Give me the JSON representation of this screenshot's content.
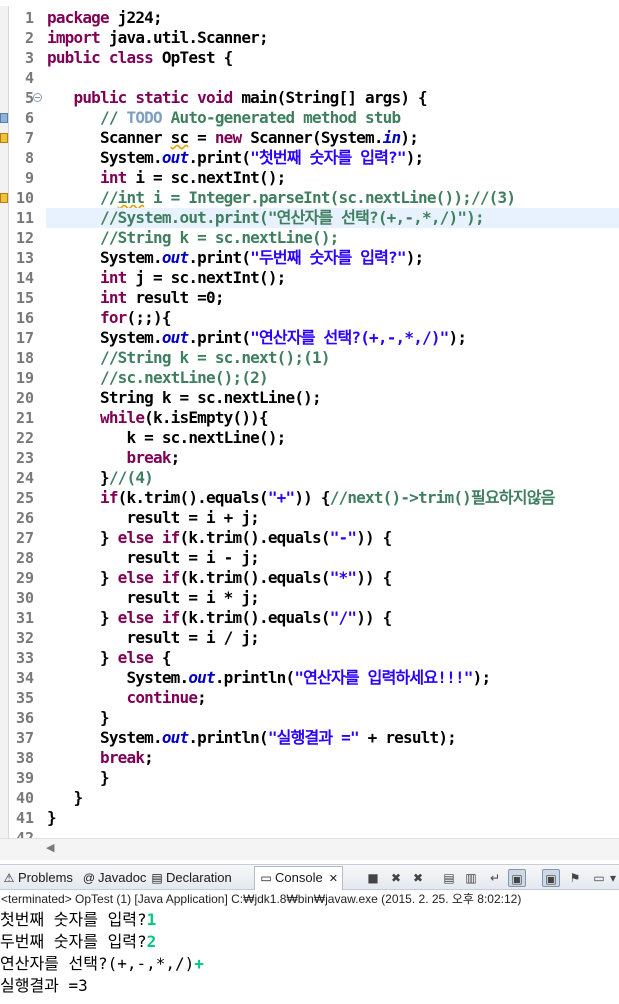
{
  "editor": {
    "lines": [
      {
        "n": "1",
        "code": [
          {
            "t": "package ",
            "c": "kw"
          },
          {
            "t": "j224;",
            "c": ""
          }
        ]
      },
      {
        "n": "2",
        "code": [
          {
            "t": "import ",
            "c": "kw"
          },
          {
            "t": "java.util.Scanner;",
            "c": ""
          }
        ]
      },
      {
        "n": "3",
        "code": [
          {
            "t": "public class ",
            "c": "kw"
          },
          {
            "t": "OpTest {",
            "c": ""
          }
        ]
      },
      {
        "n": "4",
        "code": []
      },
      {
        "n": "5",
        "code": [
          {
            "t": "   public static void ",
            "c": "kw"
          },
          {
            "t": "main(String[] args) {",
            "c": ""
          }
        ]
      },
      {
        "n": "6",
        "code": [
          {
            "t": "      // ",
            "c": "cm"
          },
          {
            "t": "TODO",
            "c": "todo"
          },
          {
            "t": " Auto-generated method stub",
            "c": "cm"
          }
        ]
      },
      {
        "n": "7",
        "code": [
          {
            "t": "      Scanner ",
            "c": ""
          },
          {
            "t": "sc",
            "c": "sq"
          },
          {
            "t": " = ",
            "c": ""
          },
          {
            "t": "new ",
            "c": "kw"
          },
          {
            "t": "Scanner(System.",
            "c": ""
          },
          {
            "t": "in",
            "c": "fld"
          },
          {
            "t": ");",
            "c": ""
          }
        ]
      },
      {
        "n": "8",
        "code": [
          {
            "t": "      System.",
            "c": ""
          },
          {
            "t": "out",
            "c": "fld"
          },
          {
            "t": ".print(",
            "c": ""
          },
          {
            "t": "\"첫번째 숫자를 입력?\"",
            "c": "str"
          },
          {
            "t": ");",
            "c": ""
          }
        ]
      },
      {
        "n": "9",
        "code": [
          {
            "t": "      int ",
            "c": "kw"
          },
          {
            "t": "i = sc.nextInt();",
            "c": ""
          }
        ]
      },
      {
        "n": "10",
        "code": [
          {
            "t": "      //",
            "c": "cm"
          },
          {
            "t": "int",
            "c": "cmsq"
          },
          {
            "t": " i = Integer.parseInt(sc.nextLine());//(3)",
            "c": "cm"
          }
        ]
      },
      {
        "n": "11",
        "code": [
          {
            "t": "      //System.out.print(\"연산자를 선택?(+,-,*,/)\");",
            "c": "cm"
          }
        ]
      },
      {
        "n": "12",
        "code": [
          {
            "t": "      //String k = sc.nextLine();",
            "c": "cm"
          }
        ]
      },
      {
        "n": "13",
        "code": [
          {
            "t": "      System.",
            "c": ""
          },
          {
            "t": "out",
            "c": "fld"
          },
          {
            "t": ".print(",
            "c": ""
          },
          {
            "t": "\"두번째 숫자를 입력?\"",
            "c": "str"
          },
          {
            "t": ");",
            "c": ""
          }
        ]
      },
      {
        "n": "14",
        "code": [
          {
            "t": "      int ",
            "c": "kw"
          },
          {
            "t": "j = sc.nextInt();",
            "c": ""
          }
        ]
      },
      {
        "n": "15",
        "code": [
          {
            "t": "      int ",
            "c": "kw"
          },
          {
            "t": "result =0;",
            "c": ""
          }
        ]
      },
      {
        "n": "16",
        "code": [
          {
            "t": "      for",
            "c": "kw"
          },
          {
            "t": "(;;){",
            "c": ""
          }
        ]
      },
      {
        "n": "17",
        "code": [
          {
            "t": "      System.",
            "c": ""
          },
          {
            "t": "out",
            "c": "fld"
          },
          {
            "t": ".print(",
            "c": ""
          },
          {
            "t": "\"연산자를 선택?(+,-,*,/)\"",
            "c": "str"
          },
          {
            "t": ");",
            "c": ""
          }
        ]
      },
      {
        "n": "18",
        "code": [
          {
            "t": "      //String k = sc.next();(1)",
            "c": "cm"
          }
        ]
      },
      {
        "n": "19",
        "code": [
          {
            "t": "      //sc.nextLine();(2)",
            "c": "cm"
          }
        ]
      },
      {
        "n": "20",
        "code": [
          {
            "t": "      String k = sc.nextLine();",
            "c": ""
          }
        ]
      },
      {
        "n": "21",
        "code": [
          {
            "t": "      while",
            "c": "kw"
          },
          {
            "t": "(k.isEmpty()){",
            "c": ""
          }
        ]
      },
      {
        "n": "22",
        "code": [
          {
            "t": "         k = sc.nextLine();",
            "c": ""
          }
        ]
      },
      {
        "n": "23",
        "code": [
          {
            "t": "         break",
            "c": "kw"
          },
          {
            "t": ";",
            "c": ""
          }
        ]
      },
      {
        "n": "24",
        "code": [
          {
            "t": "      }",
            "c": ""
          },
          {
            "t": "//(4)",
            "c": "cm"
          }
        ]
      },
      {
        "n": "25",
        "code": [
          {
            "t": "      if",
            "c": "kw"
          },
          {
            "t": "(k.trim().equals(",
            "c": ""
          },
          {
            "t": "\"+\"",
            "c": "str"
          },
          {
            "t": ")) {",
            "c": ""
          },
          {
            "t": "//next()->trim()필요하지않음",
            "c": "cm"
          }
        ]
      },
      {
        "n": "26",
        "code": [
          {
            "t": "         result = i + j;",
            "c": ""
          }
        ]
      },
      {
        "n": "27",
        "code": [
          {
            "t": "      } ",
            "c": ""
          },
          {
            "t": "else if",
            "c": "kw"
          },
          {
            "t": "(k.trim().equals(",
            "c": ""
          },
          {
            "t": "\"-\"",
            "c": "str"
          },
          {
            "t": ")) {",
            "c": ""
          }
        ]
      },
      {
        "n": "28",
        "code": [
          {
            "t": "         result = i - j;",
            "c": ""
          }
        ]
      },
      {
        "n": "29",
        "code": [
          {
            "t": "      } ",
            "c": ""
          },
          {
            "t": "else if",
            "c": "kw"
          },
          {
            "t": "(k.trim().equals(",
            "c": ""
          },
          {
            "t": "\"*\"",
            "c": "str"
          },
          {
            "t": ")) {",
            "c": ""
          }
        ]
      },
      {
        "n": "30",
        "code": [
          {
            "t": "         result = i * j;",
            "c": ""
          }
        ]
      },
      {
        "n": "31",
        "code": [
          {
            "t": "      } ",
            "c": ""
          },
          {
            "t": "else if",
            "c": "kw"
          },
          {
            "t": "(k.trim().equals(",
            "c": ""
          },
          {
            "t": "\"/\"",
            "c": "str"
          },
          {
            "t": ")) {",
            "c": ""
          }
        ]
      },
      {
        "n": "32",
        "code": [
          {
            "t": "         result = i / j;",
            "c": ""
          }
        ]
      },
      {
        "n": "33",
        "code": [
          {
            "t": "      } ",
            "c": ""
          },
          {
            "t": "else",
            "c": "kw"
          },
          {
            "t": " {",
            "c": ""
          }
        ]
      },
      {
        "n": "34",
        "code": [
          {
            "t": "         System.",
            "c": ""
          },
          {
            "t": "out",
            "c": "fld"
          },
          {
            "t": ".println(",
            "c": ""
          },
          {
            "t": "\"연산자를 입력하세요!!!\"",
            "c": "str"
          },
          {
            "t": ");",
            "c": ""
          }
        ]
      },
      {
        "n": "35",
        "code": [
          {
            "t": "         continue",
            "c": "kw"
          },
          {
            "t": ";",
            "c": ""
          }
        ]
      },
      {
        "n": "36",
        "code": [
          {
            "t": "      }",
            "c": ""
          }
        ]
      },
      {
        "n": "37",
        "code": [
          {
            "t": "      System.",
            "c": ""
          },
          {
            "t": "out",
            "c": "fld"
          },
          {
            "t": ".println(",
            "c": ""
          },
          {
            "t": "\"실행결과 =\"",
            "c": "str"
          },
          {
            "t": " + result);",
            "c": ""
          }
        ]
      },
      {
        "n": "38",
        "code": [
          {
            "t": "      break",
            "c": "kw"
          },
          {
            "t": ";",
            "c": ""
          }
        ]
      },
      {
        "n": "39",
        "code": [
          {
            "t": "      }",
            "c": ""
          }
        ]
      },
      {
        "n": "40",
        "code": [
          {
            "t": "   }",
            "c": ""
          }
        ]
      },
      {
        "n": "41",
        "code": [
          {
            "t": "}",
            "c": ""
          }
        ]
      },
      {
        "n": "42",
        "code": []
      }
    ]
  },
  "views": {
    "tabs": [
      {
        "label": "Problems",
        "icon": "problems-icon",
        "glyph": "⚠"
      },
      {
        "label": "Javadoc",
        "icon": "javadoc-icon",
        "glyph": "@"
      },
      {
        "label": "Declaration",
        "icon": "declaration-icon",
        "glyph": "▤"
      },
      {
        "label": "Console",
        "icon": "console-icon",
        "glyph": "▭",
        "active": true,
        "close": "✕"
      }
    ],
    "toolbar": [
      {
        "name": "terminate-icon",
        "glyph": "■"
      },
      {
        "name": "remove-launch-icon",
        "glyph": "✖"
      },
      {
        "name": "remove-all-terminated-icon",
        "glyph": "✖"
      },
      {
        "name": "clear-console-icon",
        "glyph": "▤"
      },
      {
        "name": "scroll-lock-icon",
        "glyph": "▥"
      },
      {
        "name": "word-wrap-icon",
        "glyph": "↵"
      },
      {
        "name": "show-on-stdout-icon",
        "glyph": "▣"
      },
      {
        "name": "show-on-stderr-icon",
        "glyph": "▣"
      },
      {
        "name": "pin-console-icon",
        "glyph": "⚑"
      },
      {
        "name": "display-selected-console-icon",
        "glyph": "▭"
      },
      {
        "name": "console-menu-icon",
        "glyph": "▾"
      },
      {
        "name": "minimize-icon",
        "glyph": "▭"
      }
    ]
  },
  "console": {
    "header": "<terminated> OpTest (1) [Java Application] C:₩jdk1.8₩bin₩javaw.exe (2015. 2. 25. 오후 8:02:12)",
    "output": [
      {
        "prompt": "첫번째 숫자를 입력?",
        "input": "1"
      },
      {
        "prompt": "두번째 숫자를 입력?",
        "input": "2"
      },
      {
        "prompt": "연산자를 선택?(+,-,*,/)",
        "input": "+"
      },
      {
        "prompt": "실행결과 =3",
        "input": ""
      }
    ]
  }
}
